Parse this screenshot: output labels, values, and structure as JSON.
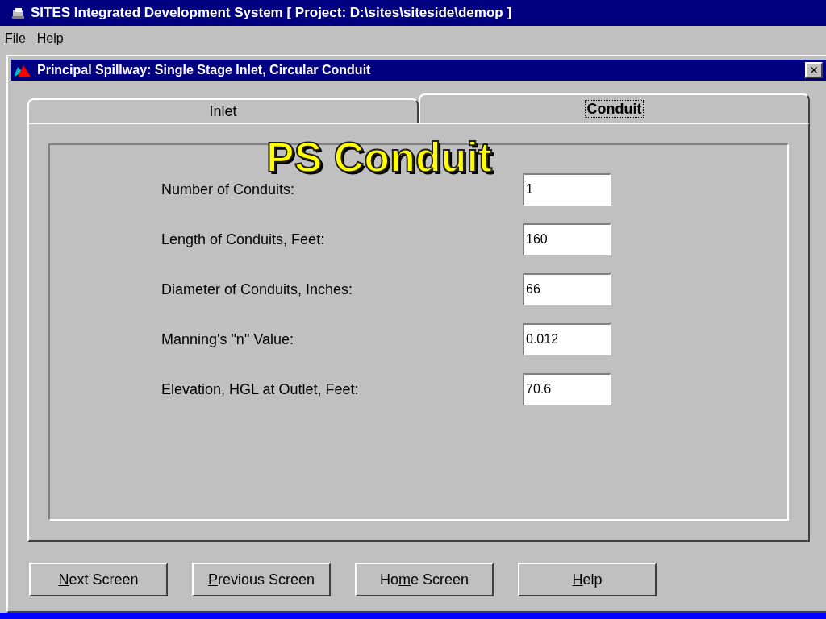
{
  "window": {
    "title": "SITES Integrated Development System [ Project: D:\\sites\\siteside\\demop ]"
  },
  "menu": [
    {
      "key": "F",
      "post": "ile"
    },
    {
      "key": "H",
      "post": "elp"
    }
  ],
  "dialog": {
    "title": "Principal Spillway: Single Stage Inlet, Circular Conduit",
    "close": "×"
  },
  "tabs": [
    {
      "label": "Inlet",
      "selected": false
    },
    {
      "label": "Conduit",
      "selected": true
    }
  ],
  "overlay_title": "PS Conduit",
  "fields": [
    {
      "label": "Number of Conduits:",
      "value": "1"
    },
    {
      "label": "Length of Conduits, Feet:",
      "value": "160"
    },
    {
      "label": "Diameter of Conduits, Inches:",
      "value": "66"
    },
    {
      "label": "Manning's \"n\" Value:",
      "value": "0.012"
    },
    {
      "label": "Elevation, HGL at Outlet, Feet:",
      "value": "70.6"
    }
  ],
  "buttons": [
    {
      "key": "N",
      "post": "ext Screen"
    },
    {
      "key": "P",
      "post": "revious Screen"
    },
    {
      "pre": "Ho",
      "key": "m",
      "post": "e Screen"
    },
    {
      "key": "H",
      "post": "elp"
    }
  ]
}
